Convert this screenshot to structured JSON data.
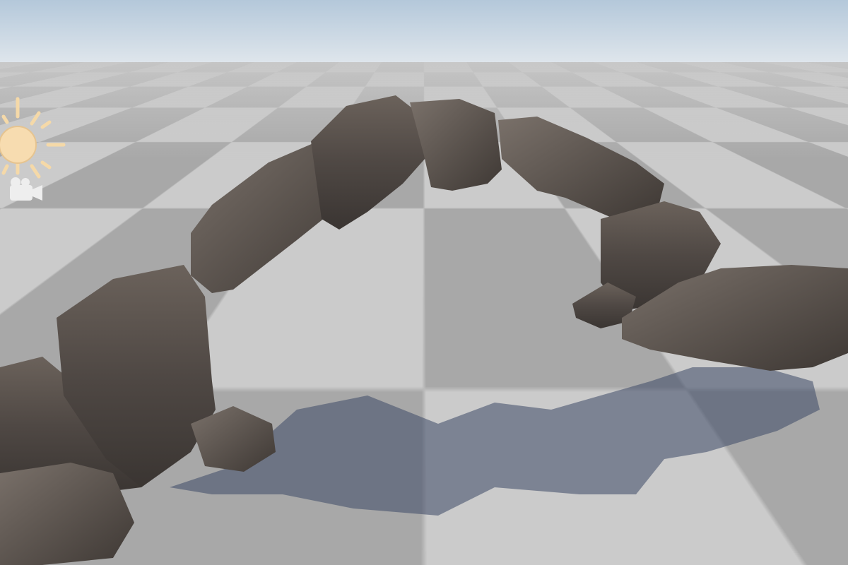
{
  "scene": {
    "view": "scene-viewport",
    "colors": {
      "sky_top": "#b4c8da",
      "sky_bottom": "#dfe6ec",
      "floor_light": "#cbcbcb",
      "floor_dark": "#a8a8a8",
      "rock": "#4e4844",
      "shadow": "#5a6580",
      "gizmo": "#f5d9a8"
    }
  },
  "gizmos": [
    {
      "icon": "directional-light-icon"
    },
    {
      "icon": "camera-icon"
    }
  ]
}
